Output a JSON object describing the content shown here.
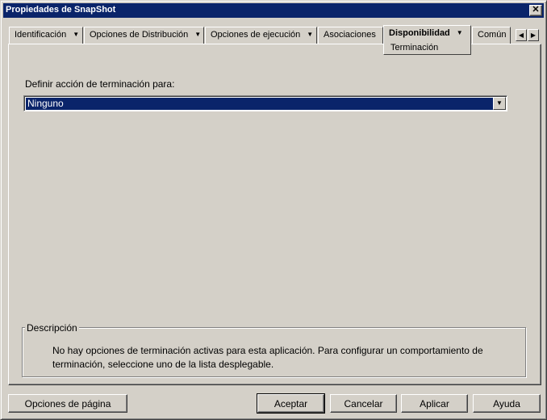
{
  "window": {
    "title": "Propiedades de SnapShot",
    "close_glyph": "✕"
  },
  "tabs": [
    {
      "label": "Identificación",
      "dropdown": true
    },
    {
      "label": "Opciones de Distribución",
      "dropdown": true
    },
    {
      "label": "Opciones de ejecución",
      "dropdown": true
    },
    {
      "label": "Asociaciones",
      "dropdown": false
    },
    {
      "label": "Disponibilidad",
      "dropdown": true,
      "active": true
    },
    {
      "label": "Común",
      "dropdown": false
    }
  ],
  "tab_arrow_glyph": "▼",
  "tab_scroll": {
    "left_glyph": "◀",
    "right_glyph": "▶"
  },
  "subtab": {
    "label": "Terminación"
  },
  "form": {
    "label": "Definir acción de terminación para:",
    "selected_value": "Ninguno",
    "dropdown_glyph": "▼"
  },
  "description": {
    "title": "Descripción",
    "text": "No hay opciones de terminación activas para esta aplicación. Para configurar un comportamiento de terminación, seleccione uno de la lista desplegable."
  },
  "buttons": {
    "page_options": "Opciones de página",
    "accept": "Aceptar",
    "cancel": "Cancelar",
    "apply": "Aplicar",
    "help": "Ayuda"
  },
  "colors": {
    "titlebar": "#0a246a",
    "face": "#d4d0c8",
    "selection": "#0a246a"
  }
}
